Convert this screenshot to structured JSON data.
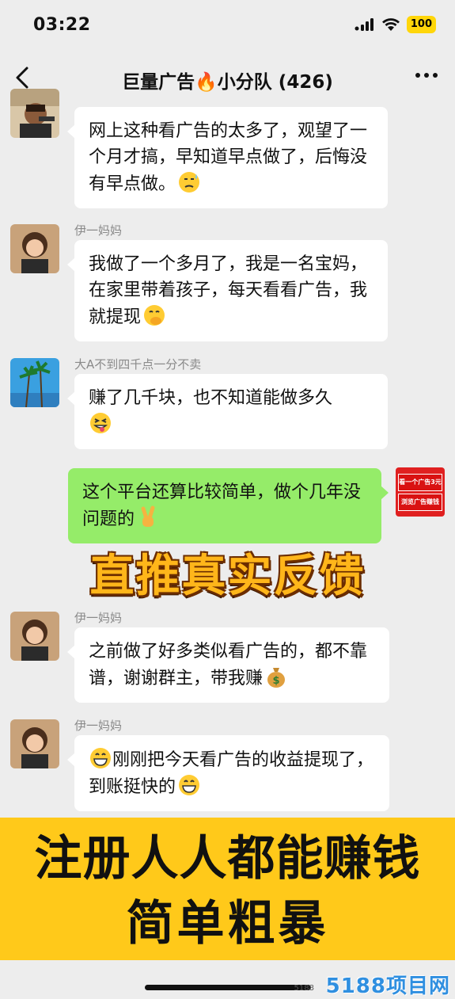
{
  "status": {
    "time": "03:22",
    "battery": "100"
  },
  "nav": {
    "title": "巨量广告🔥小分队 (426)"
  },
  "messages": [
    {
      "sender": "",
      "text": "网上这种看广告的太多了，观望了一个月才搞，早知道早点做了，后悔没有早点做。",
      "emoji": "😓"
    },
    {
      "sender": "伊一妈妈",
      "text": "我做了一个多月了，我是一名宝妈，在家里带着孩子，每天看看广告，我就提现",
      "emoji": "🤭"
    },
    {
      "sender": "大A不到四千点一分不卖",
      "text": "赚了几千块，也不知道能做多久",
      "emoji": "😝"
    },
    {
      "sender": "",
      "text": "这个平台还算比较简单，做个几年没问题的",
      "emoji": "✌️"
    },
    {
      "sender": "伊一妈妈",
      "text": "之前做了好多类似看广告的，都不靠谱，谢谢群主，带我赚",
      "emoji": "💰"
    },
    {
      "sender": "伊一妈妈",
      "text_pre_emoji": "😁",
      "text": "刚刚把今天看广告的收益提现了，到账挺快的",
      "emoji": "😁"
    }
  ],
  "self_avatar": {
    "tag1": "看一个广告3元",
    "tag2": "浏览广告赚钱"
  },
  "promo": {
    "heading": "直推真实反馈",
    "banner_line1": "注册人人都能赚钱",
    "banner_line2": "简单粗暴"
  },
  "watermark": {
    "main": "5188项目网",
    "small": "5188"
  },
  "colors": {
    "bubble_green": "#95ec69",
    "banner_yellow": "#ffc91a",
    "heading_orange": "#ffb61a",
    "watermark_blue": "#2f8fe0"
  }
}
